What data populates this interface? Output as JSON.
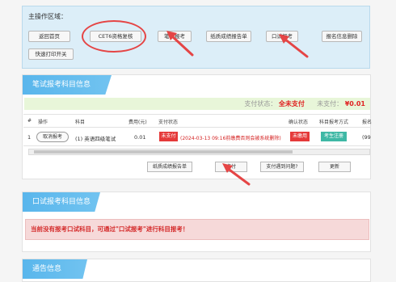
{
  "main_area": {
    "title": "主操作区域：",
    "buttons": [
      "返回首页",
      "CET6资格复核",
      "笔试报考",
      "纸质成绩报告单",
      "口试报考",
      "报名信息删除",
      "快速打印开关"
    ]
  },
  "written": {
    "header": "笔试报考科目信息",
    "status_label": "支付状态：",
    "status_value": "全未支付",
    "unpaid_label": "未支付：",
    "unpaid_value": "¥0.01",
    "columns": [
      "#",
      "操作",
      "科目",
      "费用(元)",
      "支付状态",
      "确认状态",
      "科目报考方式",
      "报名"
    ],
    "row": {
      "index": "1",
      "action": "取消报考",
      "subject": "(1) 英语四级笔试",
      "fee": "0.01",
      "pay_badge": "未支付",
      "pay_note": "(2024-03-13 09:16前缴费否则会被系统删除)",
      "confirm_badge": "未缴用",
      "method_badge": "考生注册",
      "extra": "(99"
    },
    "actions": [
      "纸质成绩报告单",
      "支付",
      "支付遇到问题?",
      "更新"
    ]
  },
  "oral": {
    "header": "口试报考科目信息",
    "notice": "当前没有报考口试科目，可通过\"口试报考\"进行科目报考！"
  },
  "notice": {
    "header": "通告信息"
  },
  "colors": {
    "header_blue": "#59b6ec",
    "status_green": "#e8f6d9",
    "alert_red": "#e02020",
    "oral_bg": "#f6d9d9",
    "method_teal": "#3eb8a5"
  }
}
